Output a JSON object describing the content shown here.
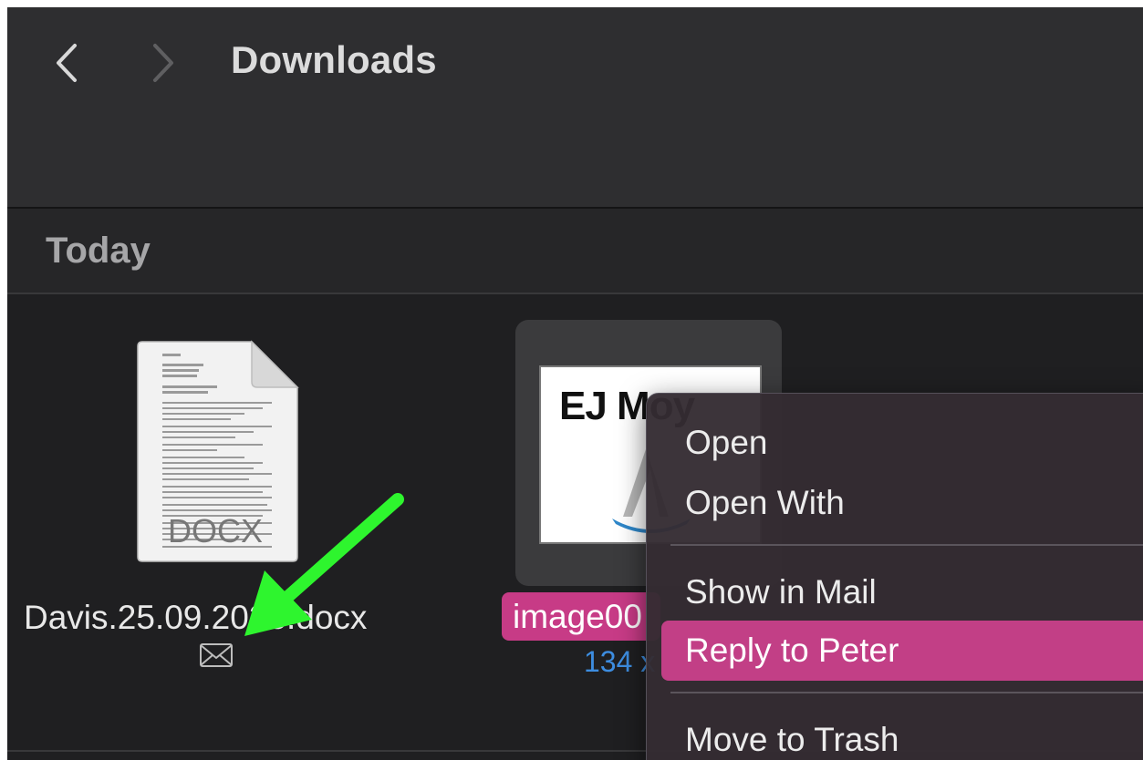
{
  "window": {
    "title": "Downloads"
  },
  "icons": {
    "back": "chevron-left-icon",
    "forward": "chevron-right-icon",
    "mail": "envelope-icon"
  },
  "section": {
    "title": "Today"
  },
  "files": [
    {
      "name": "Davis.25.09.2023.docx",
      "visible_name": "Davis.25.09.2023.docx",
      "icon_label": "DOCX"
    },
    {
      "name": "image00",
      "visible_name": "image00",
      "meta": "134 x",
      "thumb_text": "EJ Moy"
    }
  ],
  "context_menu": {
    "items": [
      {
        "label": "Open"
      },
      {
        "label": "Open With"
      },
      {
        "label": "Show in Mail"
      },
      {
        "label": "Reply to Peter"
      },
      {
        "label": "Move to Trash"
      }
    ],
    "highlighted_index": 3
  },
  "colors": {
    "accent": "#c23f86",
    "arrow": "#2ef52e",
    "meta_blue": "#3d8de0"
  }
}
